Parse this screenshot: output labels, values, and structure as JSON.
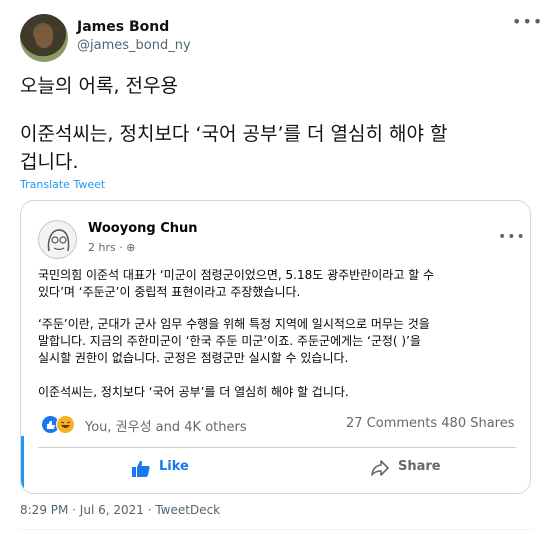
{
  "tweet": {
    "author_name": "James Bond",
    "author_handle": "@james_bond_ny",
    "more_icon": "more-horizontal-icon",
    "line1": "오늘의 어록, 전우용",
    "line2": "이준석씨는, 정치보다 ‘국어 공부’를 더 열심히 해야 할",
    "line3": "겁니다.",
    "translate_label": "Translate Tweet",
    "timestamp": "8:29 PM · Jul 6, 2021 · TweetDeck"
  },
  "embedded_post": {
    "author_name": "Wooyong Chun",
    "time": "2 hrs ·",
    "paragraph1_line1": "국민의힘 이준석 대표가 ‘미군이 점령군이었으면, 5.18도 광주반란이라고 할 수",
    "paragraph1_line2": "있다’며 ‘주둔군’이 중립적 표현이라고 주장했습니다.",
    "paragraph2_line1": "‘주둔’이란, 군대가 군사 임무 수행을 위해 특정 지역에 일시적으로 머무는 것을",
    "paragraph2_line2": "말합니다. 지금의 주한미군이 ‘한국 주둔 미군’이죠. 주둔군에게는 ‘군정(     )’을",
    "paragraph2_line3": "실시할 권한이 없습니다. 군정은 점령군만 실시할 수 있습니다.",
    "paragraph3": "이준석씨는, 정치보다 ‘국어 공부’를 더 열심히 해야 할 겁니다.",
    "reactions_text": "You, 권우성 and 4K others",
    "comments": "27 Comments",
    "shares": "480 Shares",
    "like_label": "Like",
    "share_label": "Share"
  },
  "colors": {
    "twitter_blue": "#1d9bf0",
    "facebook_blue": "#1877f2",
    "secondary_text": "#536471"
  }
}
